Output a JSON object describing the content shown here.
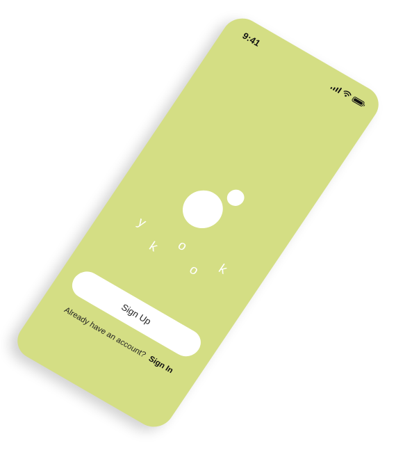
{
  "colors": {
    "screen_bg": "#d4de84",
    "logo": "#ffffff",
    "button_bg": "#ffffff",
    "text_dark": "#222222"
  },
  "status_bar": {
    "time": "9:41",
    "icons": [
      "signal-icon",
      "wifi-icon",
      "battery-icon"
    ]
  },
  "brand": {
    "name": "y o k k o"
  },
  "actions": {
    "signup_label": "Sign Up",
    "signin_prompt": "Already have an account?",
    "signin_label": "Sign In"
  }
}
